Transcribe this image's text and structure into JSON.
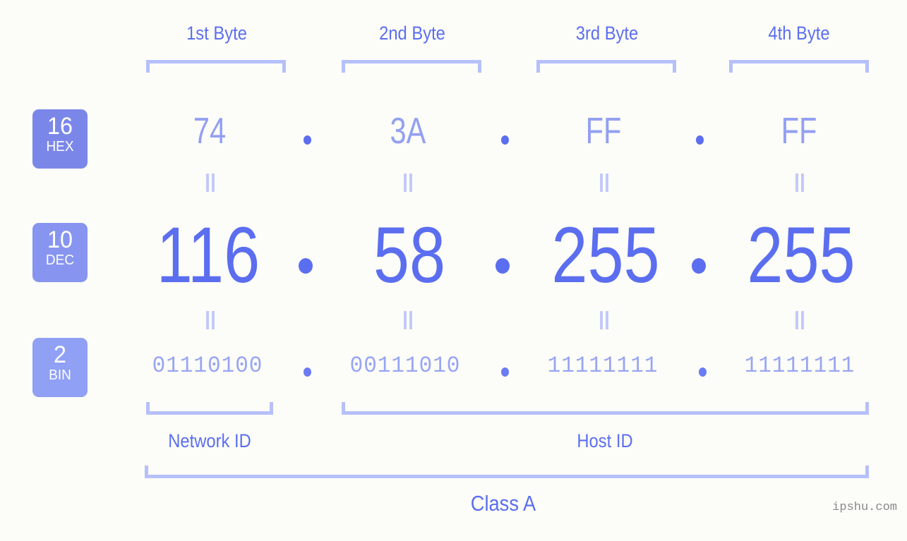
{
  "page": {
    "background_color": "#fcfdf8",
    "accent_color": "#5b6ef0",
    "bracket_color": "#b6c0fa",
    "watermark": "ipshu.com"
  },
  "byte_headers": [
    {
      "label": "1st Byte"
    },
    {
      "label": "2nd Byte"
    },
    {
      "label": "3rd Byte"
    },
    {
      "label": "4th Byte"
    }
  ],
  "radix_badges": [
    {
      "number": "16",
      "unit": "HEX",
      "color": "#7b87e8"
    },
    {
      "number": "10",
      "unit": "DEC",
      "color": "#8795f0"
    },
    {
      "number": "2",
      "unit": "BIN",
      "color": "#8fa0f5"
    }
  ],
  "rows": {
    "hex": {
      "name": "hexadecimal",
      "values": [
        "74",
        "3A",
        "FF",
        "FF"
      ],
      "separator": "."
    },
    "dec": {
      "name": "decimal",
      "values": [
        "116",
        "58",
        "255",
        "255"
      ],
      "separator": "."
    },
    "bin": {
      "name": "binary",
      "values": [
        "01110100",
        "00111010",
        "11111111",
        "11111111"
      ],
      "separator": "."
    }
  },
  "equality_marks": {
    "symbol": "‖",
    "count_per_row": 4
  },
  "sections": [
    {
      "label": "Network ID"
    },
    {
      "label": "Host ID"
    }
  ],
  "class": {
    "label": "Class A"
  }
}
